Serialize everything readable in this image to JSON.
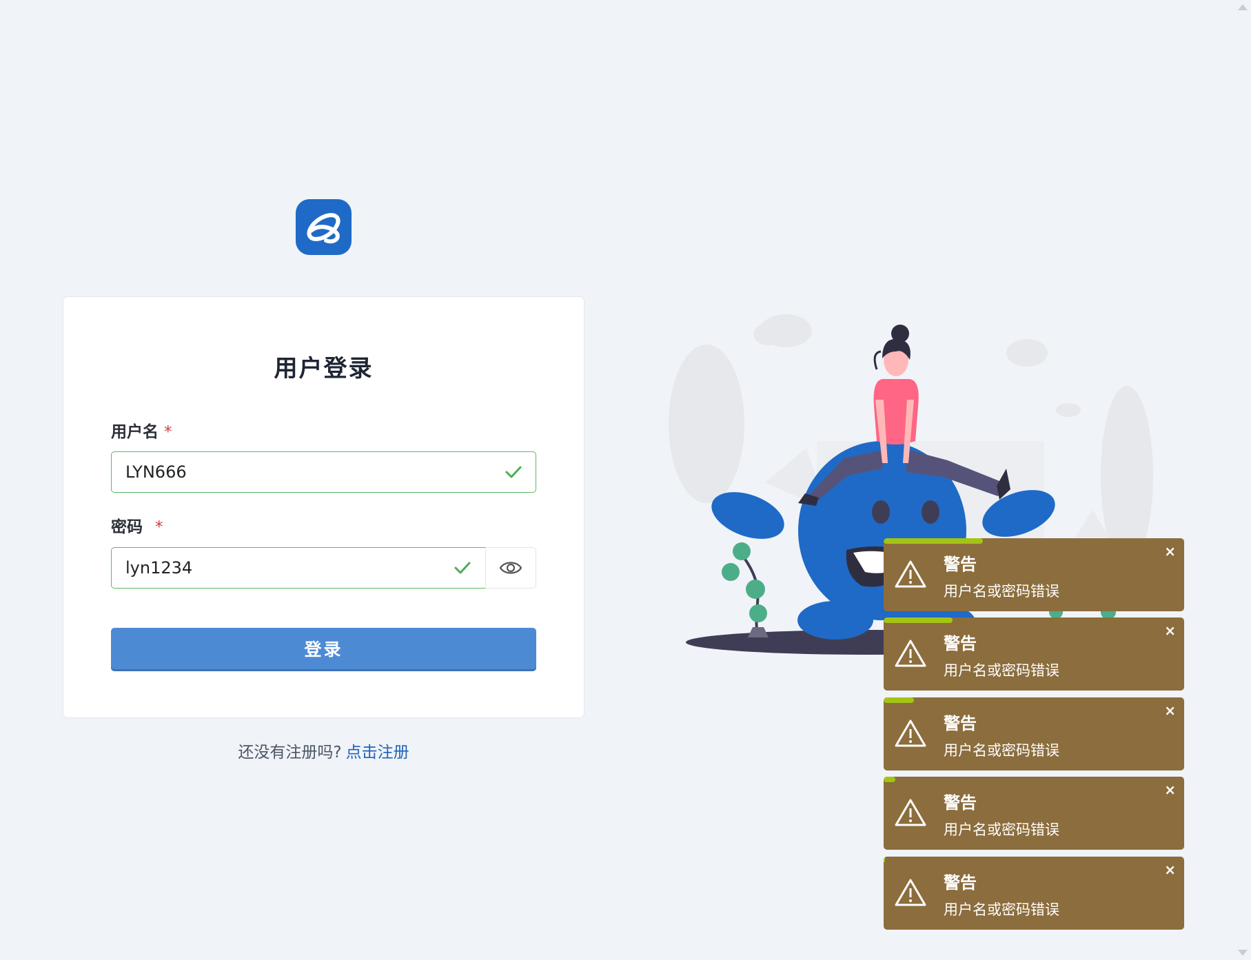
{
  "login": {
    "title": "用户登录",
    "username_label": "用户名",
    "password_label": "密码",
    "required_mark": "*",
    "username_value": "LYN666",
    "password_value": "lyn1234",
    "login_button": "登录"
  },
  "register": {
    "prompt": "还没有注册吗?",
    "link": "点击注册"
  },
  "icons": {
    "logo": "app-logo-icon",
    "valid": "checkmark-icon",
    "show_password": "eye-icon",
    "warning": "warning-triangle-icon",
    "close": "close-icon"
  },
  "colors": {
    "primary": "#4d8ad4",
    "valid_border": "#5ab961",
    "toast_bg": "#8c6d3d",
    "toast_progress": "#a3c414",
    "link": "#1e62b8",
    "required": "#d4393c"
  },
  "toasts": [
    {
      "title": "警告",
      "message": "用户名或密码错误",
      "close": "×",
      "progress": 0.33
    },
    {
      "title": "警告",
      "message": "用户名或密码错误",
      "close": "×",
      "progress": 0.23
    },
    {
      "title": "警告",
      "message": "用户名或密码错误",
      "close": "×",
      "progress": 0.1
    },
    {
      "title": "警告",
      "message": "用户名或密码错误",
      "close": "×",
      "progress": 0.04
    },
    {
      "title": "警告",
      "message": "用户名或密码错误",
      "close": "×",
      "progress": 0.005
    }
  ]
}
